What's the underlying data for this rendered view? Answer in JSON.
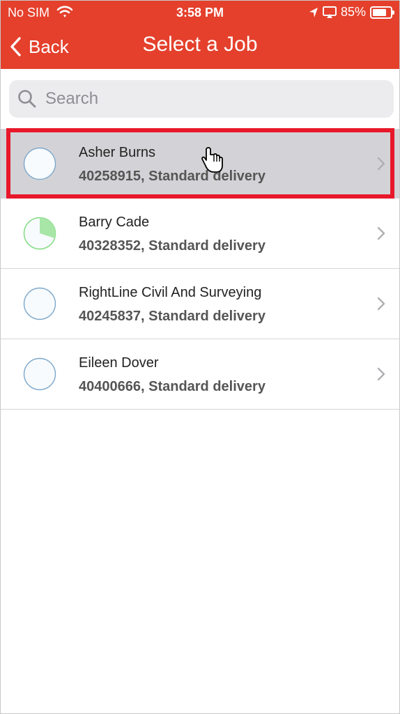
{
  "status_bar": {
    "carrier": "No SIM",
    "time": "3:58 PM",
    "battery": "85%",
    "battery_level": 0.85
  },
  "nav": {
    "back_label": "Back",
    "title": "Select a Job"
  },
  "search": {
    "placeholder": "Search",
    "value": ""
  },
  "jobs": [
    {
      "name": "Asher Burns",
      "detail": "40258915, Standard delivery",
      "progress": 0,
      "selected": true
    },
    {
      "name": "Barry Cade",
      "detail": "40328352, Standard delivery",
      "progress": 0.3,
      "selected": false
    },
    {
      "name": "RightLine Civil And Surveying",
      "detail": "40245837, Standard delivery",
      "progress": 0,
      "selected": false
    },
    {
      "name": "Eileen Dover",
      "detail": "40400666, Standard delivery",
      "progress": 0,
      "selected": false
    }
  ],
  "colors": {
    "accent": "#e4402c",
    "progress_fill": "#a8e6a8",
    "progress_stroke": "#7fd97f",
    "empty_stroke": "#7fa9cc",
    "highlight": "#e8182b"
  },
  "icons": {
    "back": "chevron-left-icon",
    "search": "search-icon",
    "row": "chevron-right-icon",
    "cursor": "hand-cursor-icon"
  }
}
